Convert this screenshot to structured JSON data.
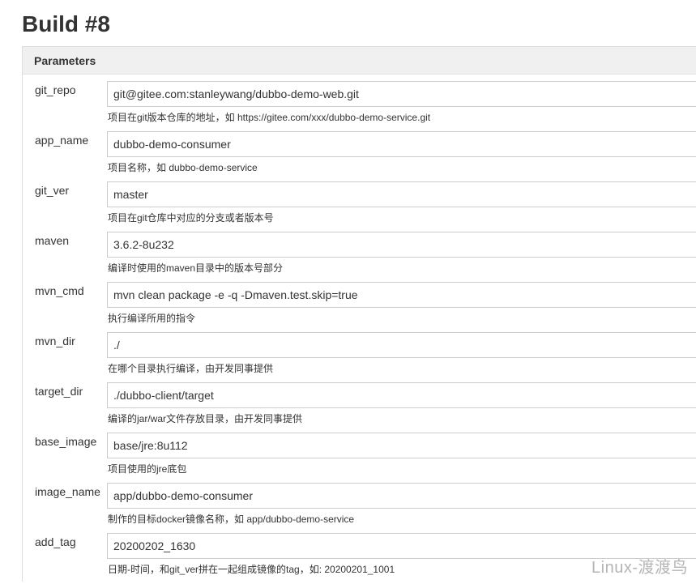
{
  "page": {
    "title": "Build #8"
  },
  "panel": {
    "header": "Parameters"
  },
  "params": [
    {
      "name": "git_repo",
      "value": "git@gitee.com:stanleywang/dubbo-demo-web.git",
      "description": "项目在git版本仓库的地址，如 https://gitee.com/xxx/dubbo-demo-service.git"
    },
    {
      "name": "app_name",
      "value": "dubbo-demo-consumer",
      "description": "项目名称，如 dubbo-demo-service"
    },
    {
      "name": "git_ver",
      "value": "master",
      "description": "项目在git仓库中对应的分支或者版本号"
    },
    {
      "name": "maven",
      "value": "3.6.2-8u232",
      "description": "编译时使用的maven目录中的版本号部分"
    },
    {
      "name": "mvn_cmd",
      "value": "mvn clean package -e -q -Dmaven.test.skip=true",
      "description": "执行编译所用的指令"
    },
    {
      "name": "mvn_dir",
      "value": "./",
      "description": "在哪个目录执行编译，由开发同事提供"
    },
    {
      "name": "target_dir",
      "value": "./dubbo-client/target",
      "description": "编译的jar/war文件存放目录，由开发同事提供"
    },
    {
      "name": "base_image",
      "value": "base/jre:8u112",
      "description": "项目使用的jre底包"
    },
    {
      "name": "image_name",
      "value": "app/dubbo-demo-consumer",
      "description": "制作的目标docker镜像名称，如 app/dubbo-demo-service"
    },
    {
      "name": "add_tag",
      "value": "20200202_1630",
      "description": "日期-时间，和git_ver拼在一起组成镜像的tag，如: 20200201_1001"
    }
  ],
  "watermark": "Linux-渡渡鸟"
}
